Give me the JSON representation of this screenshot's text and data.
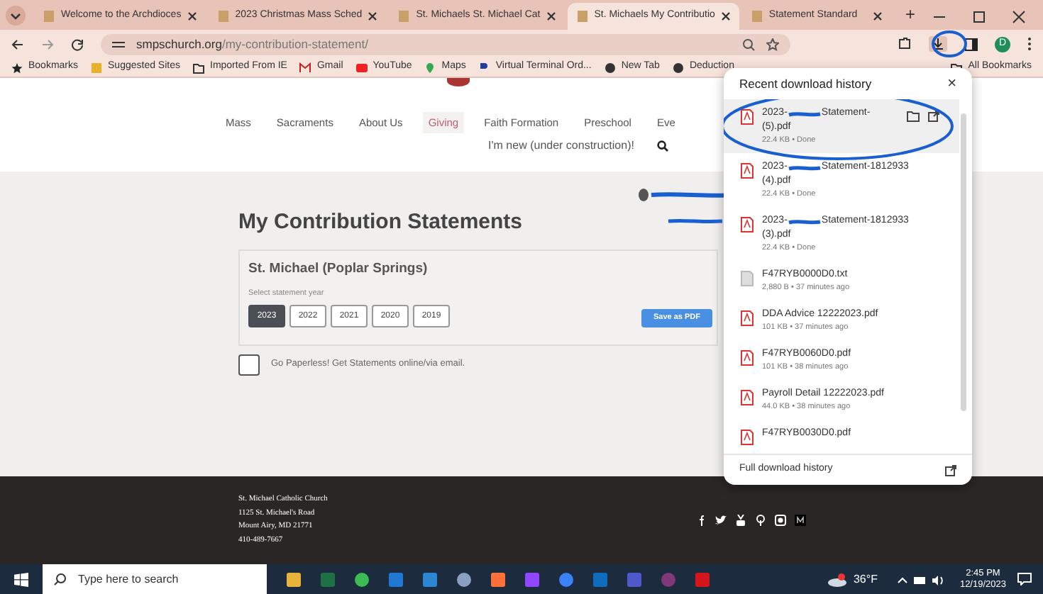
{
  "tabs": [
    {
      "title": "Welcome to the Archdioces",
      "selected": false
    },
    {
      "title": "2023 Christmas Mass Sched",
      "selected": false
    },
    {
      "title": "St. Michaels St. Michael Cat",
      "selected": false
    },
    {
      "title": "St. Michaels My Contributio",
      "selected": true
    },
    {
      "title": "Statement Standard",
      "selected": false
    }
  ],
  "new_tab": "+",
  "address": {
    "host": "smpschurch.org",
    "path": "/my-contribution-statement/"
  },
  "profile_initial": "D",
  "bookmarks": [
    "Bookmarks",
    "Suggested Sites",
    "Imported From IE",
    "Gmail",
    "YouTube",
    "Maps",
    "Virtual Terminal Ord...",
    "New Tab",
    "Deduction"
  ],
  "all_bookmarks": "All Bookmarks",
  "nav": [
    {
      "label": "Mass",
      "selected": false
    },
    {
      "label": "Sacraments",
      "selected": false
    },
    {
      "label": "About Us",
      "selected": false
    },
    {
      "label": "Giving",
      "selected": true
    },
    {
      "label": "Faith Formation",
      "selected": false
    },
    {
      "label": "Preschool",
      "selected": false
    },
    {
      "label": "Eve",
      "selected": false
    }
  ],
  "nav_second": "I'm new (under construction)!",
  "heading": "My Contribution Statements",
  "parish": "St. Michael (Poplar Springs)",
  "year_label": "Select statement year",
  "years": [
    {
      "label": "2023",
      "selected": true
    },
    {
      "label": "2022",
      "selected": false
    },
    {
      "label": "2021",
      "selected": false
    },
    {
      "label": "2020",
      "selected": false
    },
    {
      "label": "2019",
      "selected": false
    }
  ],
  "save_button": "Save as PDF",
  "paperless": {
    "label": "Go Paperless! Get Statements online/via email.",
    "checked": false
  },
  "footer": {
    "lines": [
      "St. Michael Catholic Church",
      "1125 St. Michael's Road",
      "Mount Airy, MD 21771",
      "410-489-7667"
    ]
  },
  "downloads": {
    "title": "Recent download history",
    "close": "×",
    "items": [
      {
        "kind": "pdf",
        "name_before": "2023-",
        "redacted": true,
        "name_after": "Statement-",
        "name_line2": "(5).pdf",
        "meta": "22.4 KB • Done",
        "selected": true
      },
      {
        "kind": "pdf",
        "name_before": "2023-",
        "redacted": true,
        "name_after": "Statement-1812933",
        "name_line2": "(4).pdf",
        "meta": "22.4 KB • Done",
        "selected": false
      },
      {
        "kind": "pdf",
        "name_before": "2023-",
        "redacted": true,
        "name_after": "Statement-1812933",
        "name_line2": "(3).pdf",
        "meta": "22.4 KB • Done",
        "selected": false
      },
      {
        "kind": "txt",
        "name_before": "F47RYB0000D0.txt",
        "redacted": false,
        "meta": "2,880 B • 37 minutes ago",
        "selected": false
      },
      {
        "kind": "pdf",
        "name_before": "DDA Advice 12222023.pdf",
        "redacted": false,
        "meta": "101 KB • 37 minutes ago",
        "selected": false
      },
      {
        "kind": "pdf",
        "name_before": "F47RYB0060D0.pdf",
        "redacted": false,
        "meta": "101 KB • 38 minutes ago",
        "selected": false
      },
      {
        "kind": "pdf",
        "name_before": "Payroll Detail 12222023.pdf",
        "redacted": false,
        "meta": "44.0 KB • 38 minutes ago",
        "selected": false
      },
      {
        "kind": "pdf",
        "name_before": "F47RYB0030D0.pdf",
        "redacted": false,
        "selected": false
      }
    ],
    "full_history": "Full download history"
  },
  "taskbar": {
    "search_placeholder": "Type here to search",
    "temperature": "36°F",
    "time": "2:45 PM",
    "date": "12/19/2023"
  }
}
